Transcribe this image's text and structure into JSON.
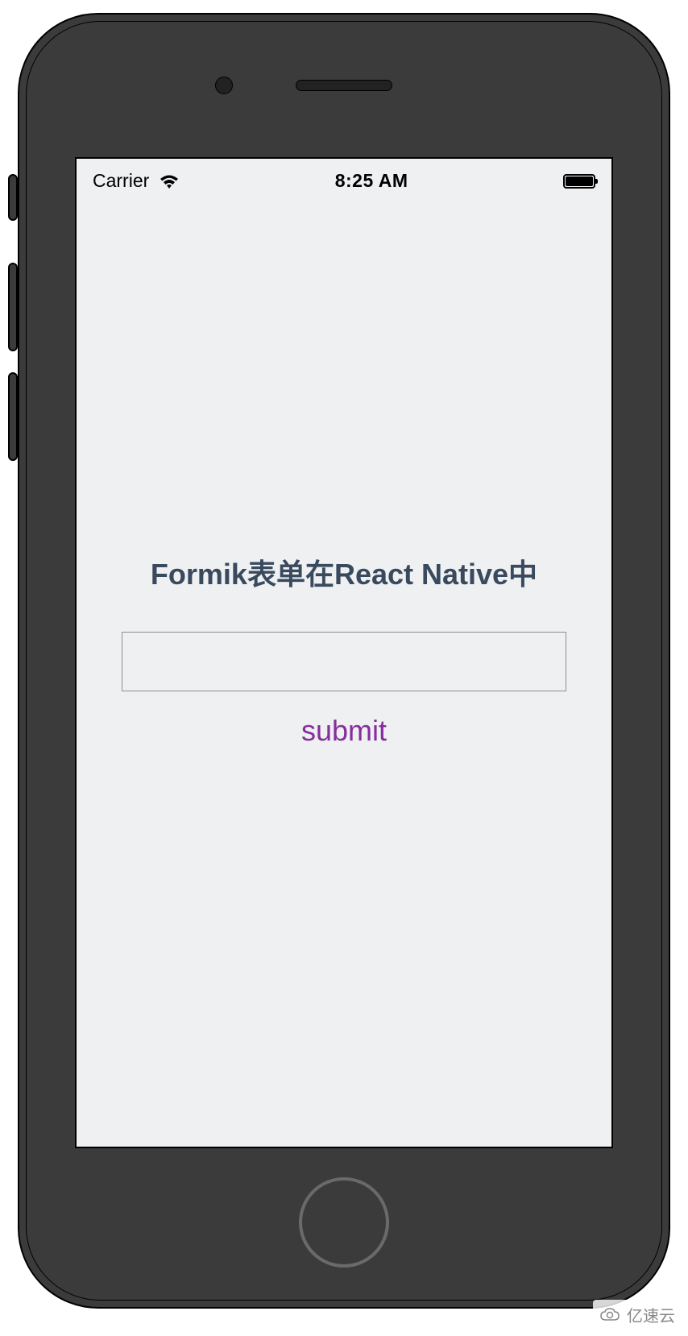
{
  "status_bar": {
    "carrier": "Carrier",
    "time": "8:25 AM"
  },
  "form": {
    "title": "Formik表单在React Native中",
    "input_value": "",
    "submit_label": "submit"
  },
  "watermark": {
    "text": "亿速云"
  }
}
